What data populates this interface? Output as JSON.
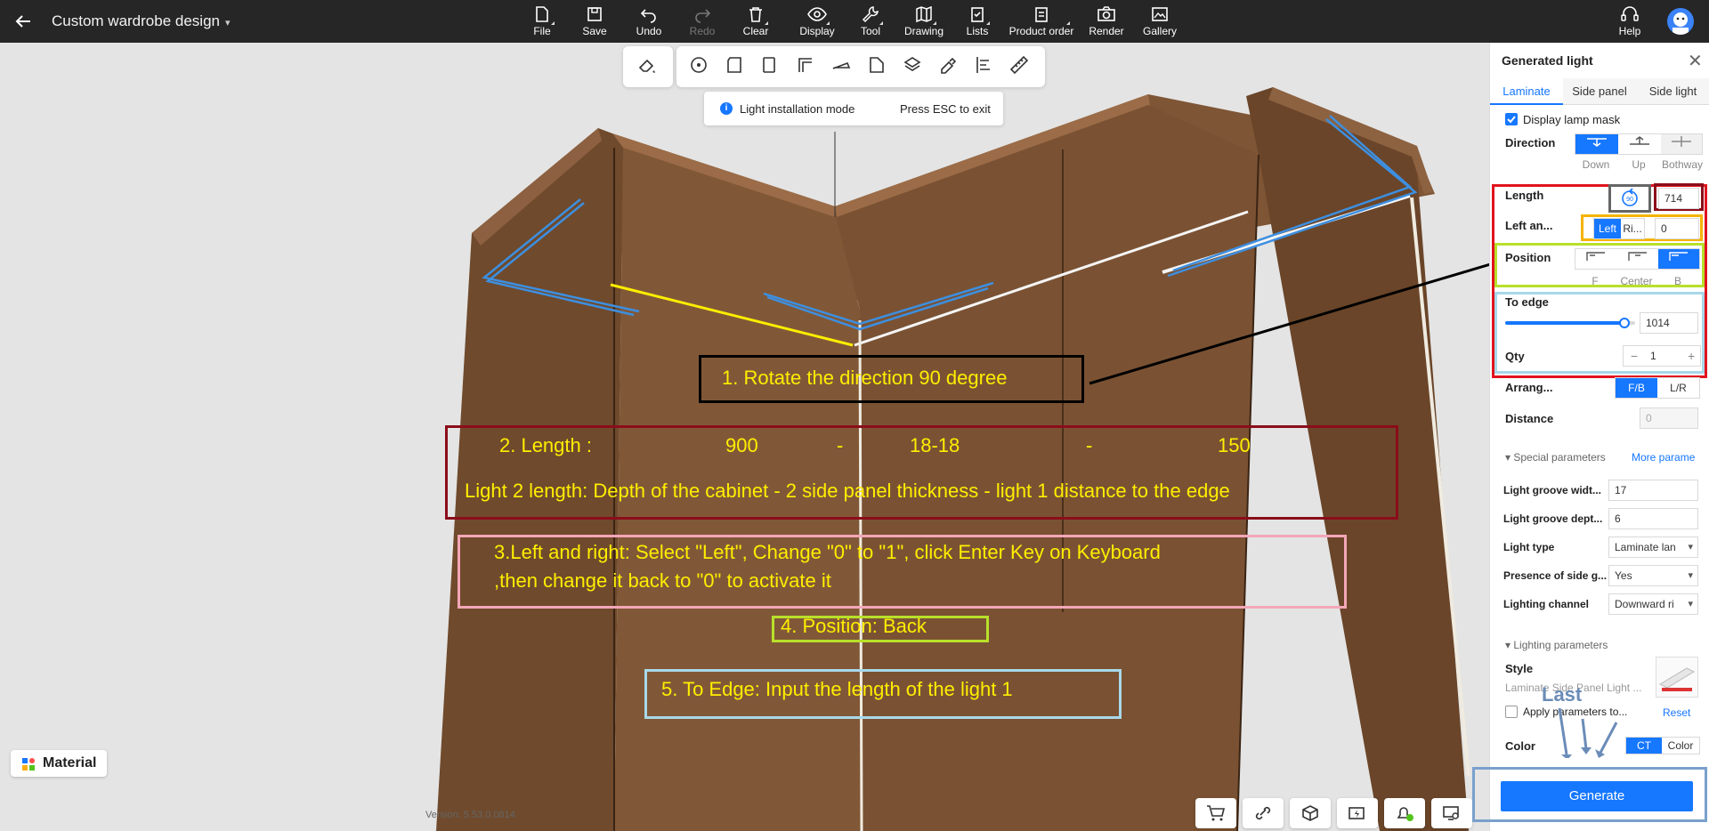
{
  "header": {
    "title": "Custom wardrobe design",
    "toolbar": [
      {
        "label": "File",
        "icon": "file-icon"
      },
      {
        "label": "Save",
        "icon": "save-icon"
      },
      {
        "label": "Undo",
        "icon": "undo-icon"
      },
      {
        "label": "Redo",
        "icon": "redo-icon",
        "disabled": true
      },
      {
        "label": "Clear",
        "icon": "trash-icon"
      },
      {
        "label": "Display",
        "icon": "eye-icon"
      },
      {
        "label": "Tool",
        "icon": "wrench-icon"
      },
      {
        "label": "Drawing",
        "icon": "map-icon"
      },
      {
        "label": "Lists",
        "icon": "clipboard-icon"
      },
      {
        "label": "Product order",
        "icon": "order-icon"
      },
      {
        "label": "Render",
        "icon": "camera-icon"
      },
      {
        "label": "Gallery",
        "icon": "image-icon"
      }
    ],
    "help_label": "Help"
  },
  "viewport": {
    "hint_mode": "Light installation mode",
    "hint_esc": "Press ESC to exit",
    "material_label": "Material",
    "version": "Version: 5.53.0.0814"
  },
  "annotations": {
    "step1": "1. Rotate the direction 90 degree",
    "step2_label": "2. Length :",
    "step2_a": "900",
    "step2_minus1": "-",
    "step2_b": "18-18",
    "step2_minus2": "-",
    "step2_c": "150",
    "step2_desc": "Light 2 length: Depth of the cabinet - 2 side panel thickness - light 1 distance to the edge",
    "step3_line1": "3.Left and right: Select \"Left\", Change \"0\" to \"1\", click Enter Key on Keyboard",
    "step3_line2": ",then change it back to \"0\" to activate it",
    "step4": "4. Position: Back",
    "step5": "5. To Edge: Input the length of the light 1",
    "last": "Last"
  },
  "panel": {
    "title": "Generated light",
    "tabs": [
      "Laminate",
      "Side panel",
      "Side light"
    ],
    "display_lamp_mask": "Display lamp mask",
    "direction_label": "Direction",
    "direction_options": [
      "Down",
      "Up",
      "Bothway"
    ],
    "length_label": "Length",
    "length_value": "714",
    "left_right_label": "Left an...",
    "left_right_options": [
      "Left",
      "Ri..."
    ],
    "left_right_value": "0",
    "position_label": "Position",
    "position_options": [
      "F",
      "Center",
      "B"
    ],
    "to_edge_label": "To edge",
    "to_edge_value": "1014",
    "to_edge_level": 0.92,
    "qty_label": "Qty",
    "qty_value": "1",
    "qty_minus": "−",
    "qty_plus": "+",
    "arrange_label": "Arrang...",
    "arrange_options": [
      "F/B",
      "L/R"
    ],
    "distance_label": "Distance",
    "distance_value": "0",
    "special_params": "Special parameters",
    "more_params": "More parame",
    "groove_width_label": "Light groove widt...",
    "groove_width_value": "17",
    "groove_depth_label": "Light groove dept...",
    "groove_depth_value": "6",
    "light_type_label": "Light type",
    "light_type_value": "Laminate lan",
    "presence_label": "Presence of side g...",
    "presence_value": "Yes",
    "channel_label": "Lighting channel",
    "channel_value": "Downward ri",
    "lighting_params": "Lighting parameters",
    "style_label": "Style",
    "style_value": "Laminate Side Panel Light ...",
    "apply_label": "Apply parameters to...",
    "reset_label": "Reset",
    "color_label": "Color",
    "color_options": [
      "CT",
      "Color"
    ],
    "generate_label": "Generate"
  },
  "colors": {
    "accent": "#1677ff",
    "annotation_text": "#ffee00",
    "wood": "#8b5e3c"
  }
}
